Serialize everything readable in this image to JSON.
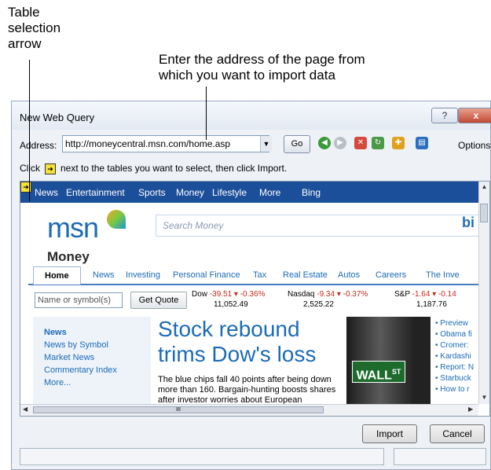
{
  "callouts": {
    "table_arrow": [
      "Table",
      "selection",
      "arrow"
    ],
    "address": [
      "Enter the address of the page from",
      "which you want to import data"
    ]
  },
  "dialog": {
    "title": "New Web Query",
    "help_label": "?",
    "close_label": "x",
    "address_label": "Address:",
    "address_value": "http://moneycentral.msn.com/home.asp",
    "go_label": "Go",
    "options_label": "Options...",
    "hint_before": "Click",
    "hint_after": "next to the tables you want to select, then click Import.",
    "import_label": "Import",
    "cancel_label": "Cancel"
  },
  "page": {
    "nav": [
      "News",
      "Entertainment",
      "Sports",
      "Money",
      "Lifestyle",
      "More",
      "Bing"
    ],
    "logo": "msn",
    "search_placeholder": "Search Money",
    "search_brand": "bi",
    "section": "Money",
    "tabs": [
      "Home",
      "News",
      "Investing",
      "Personal Finance",
      "Tax",
      "Real Estate",
      "Autos",
      "Careers",
      "The Inve"
    ],
    "symbol_placeholder": "Name or symbol(s)",
    "quote_button": "Get Quote",
    "tickers": [
      {
        "name": "Dow",
        "change": "-39.51 ▾ -0.36%",
        "value": "11,052.49"
      },
      {
        "name": "Nasdaq",
        "change": "-9.34 ▾ -0.37%",
        "value": "2,525.22"
      },
      {
        "name": "S&P",
        "change": "-1.64 ▾ -0.14",
        "value": "1,187.76"
      }
    ],
    "left_links": [
      "News",
      "News by Symbol",
      "Market News",
      "Commentary Index",
      "More..."
    ],
    "headline": "Stock rebound trims Dow's loss",
    "blurb": "The blue chips fall 40 points after being down more than 160. Bargain-hunting boosts shares after investor worries about European",
    "photo_sign": "WALL",
    "photo_sign_sup": "ST",
    "bullets": [
      "• Preview",
      "• Obama fi",
      "• Cromer:",
      "• Kardashi",
      "• Report: N",
      "• Starbuck",
      "• How to r"
    ]
  }
}
